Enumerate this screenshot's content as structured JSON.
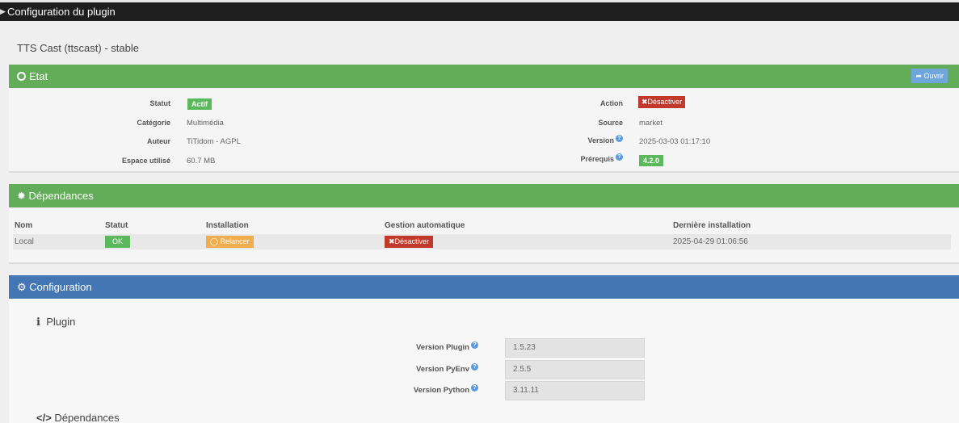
{
  "window": {
    "title": "Configuration du plugin"
  },
  "plugin": {
    "title": "TTS Cast (ttscast) - stable"
  },
  "etat": {
    "header": "Etat",
    "open_button": "Ouvrir",
    "statut_label": "Statut",
    "statut_value": "Actif",
    "categorie_label": "Catégorie",
    "categorie_value": "Multimédia",
    "auteur_label": "Auteur",
    "auteur_value": "TiTidom - AGPL",
    "espace_label": "Espace utilisé",
    "espace_value": "60.7 MB",
    "action_label": "Action",
    "action_button": "Désactiver",
    "source_label": "Source",
    "source_value": "market",
    "version_label": "Version",
    "version_value": "2025-03-03 01:17:10",
    "prerequis_label": "Prérequis",
    "prerequis_value": "4.2.0"
  },
  "dependances": {
    "header": "Dépendances",
    "columns": [
      "Nom",
      "Statut",
      "Installation",
      "Gestion automatique",
      "Dernière installation"
    ],
    "row": {
      "nom": "Local",
      "statut": "OK",
      "installation": "Relancer",
      "gestion": "Désactiver",
      "derniere": "2025-04-29 01:06:56"
    }
  },
  "configuration": {
    "header": "Configuration",
    "plugin_section": "Plugin",
    "fields": [
      {
        "label": "Version Plugin",
        "value": "1.5.23"
      },
      {
        "label": "Version PyEnv",
        "value": "2.5.5"
      },
      {
        "label": "Version Python",
        "value": "3.11.11"
      }
    ],
    "dep_section": "Dépendances"
  },
  "colors": {
    "green": "#62ac5a",
    "blue": "#4476b3",
    "red": "#c0392b",
    "orange": "#f0ad4e",
    "help": "#5c9be0"
  }
}
